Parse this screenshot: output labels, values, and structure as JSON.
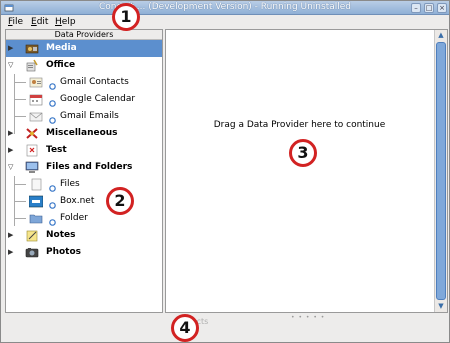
{
  "window": {
    "title": "Conduit 0.3.x (Development Version) - Running Uninstalled",
    "title_visible": "Conduit  ...  (Development Version) - Running Uninstalled",
    "controls": {
      "minimize": "–",
      "maximize": "□",
      "close": "×"
    }
  },
  "menubar": {
    "file": {
      "accel": "F",
      "rest": "ile"
    },
    "edit": {
      "accel": "E",
      "rest": "dit"
    },
    "help": {
      "accel": "H",
      "rest": "elp"
    }
  },
  "sidebar": {
    "header": "Data Providers",
    "items": [
      {
        "label": "Media",
        "kind": "category",
        "icon": "media-icon"
      },
      {
        "label": "Office",
        "kind": "category",
        "icon": "office-icon"
      },
      {
        "label": "Gmail Contacts",
        "kind": "child",
        "icon": "contacts-icon"
      },
      {
        "label": "Google Calendar",
        "kind": "child",
        "icon": "calendar-icon"
      },
      {
        "label": "Gmail Emails",
        "kind": "child",
        "icon": "email-icon"
      },
      {
        "label": "Miscellaneous",
        "kind": "category",
        "icon": "misc-icon"
      },
      {
        "label": "Test",
        "kind": "category",
        "icon": "test-icon"
      },
      {
        "label": "Files and Folders",
        "kind": "category",
        "icon": "computer-icon"
      },
      {
        "label": "Files",
        "kind": "child",
        "icon": "file-icon"
      },
      {
        "label": "Box.net",
        "kind": "child",
        "icon": "boxnet-icon"
      },
      {
        "label": "Folder",
        "kind": "child",
        "icon": "folder-icon"
      },
      {
        "label": "Notes",
        "kind": "category",
        "icon": "notes-icon"
      },
      {
        "label": "Photos",
        "kind": "category",
        "icon": "photos-icon"
      }
    ]
  },
  "canvas": {
    "message": "Drag a Data Provider here to continue"
  },
  "bottombar": {
    "actions_label": "...cts"
  },
  "callouts": [
    "1",
    "2",
    "3",
    "4"
  ],
  "colors": {
    "selection": "#5c8fce",
    "callout_border": "#d22222",
    "titlebar": "#9fbbe0"
  }
}
